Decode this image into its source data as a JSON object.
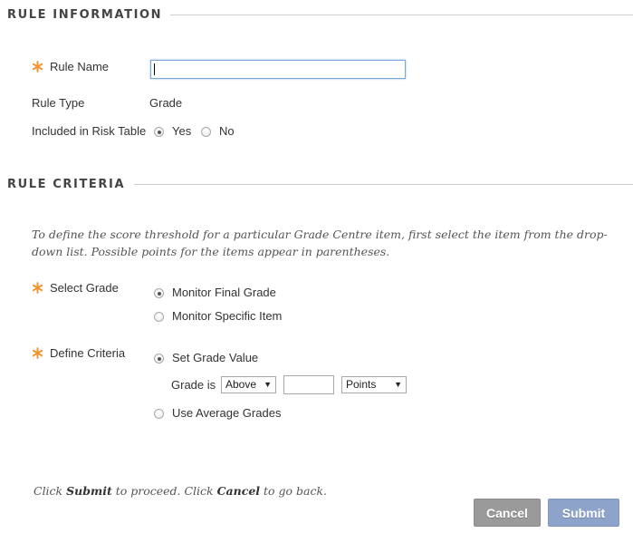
{
  "rule_information": {
    "title": "RULE INFORMATION",
    "rule_name": {
      "label": "Rule Name",
      "value": ""
    },
    "rule_type": {
      "label": "Rule Type",
      "value": "Grade"
    },
    "risk_table": {
      "label": "Included in Risk Table",
      "options": [
        {
          "label": "Yes",
          "selected": true
        },
        {
          "label": "No",
          "selected": false
        }
      ]
    }
  },
  "rule_criteria": {
    "title": "RULE CRITERIA",
    "instructions": "To define the score threshold for a particular Grade Centre item, first select the item from the drop-down list. Possible points for the items appear in parentheses.",
    "select_grade": {
      "label": "Select Grade",
      "options": [
        {
          "label": "Monitor Final Grade",
          "selected": true
        },
        {
          "label": "Monitor Specific Item",
          "selected": false
        }
      ]
    },
    "define_criteria": {
      "label": "Define Criteria",
      "set_grade_value": {
        "label": "Set Grade Value",
        "selected": true
      },
      "grade_is_label": "Grade is",
      "comparison": "Above",
      "threshold_value": "",
      "unit": "Points",
      "use_average": {
        "label": "Use Average Grades",
        "selected": false
      }
    }
  },
  "footer": {
    "submit_word": "Submit",
    "cancel_word": "Cancel",
    "hint_parts": [
      "Click ",
      "Submit",
      " to proceed. Click ",
      "Cancel",
      " to go back."
    ],
    "cancel_button": "Cancel",
    "submit_button": "Submit"
  },
  "colors": {
    "required_asterisk": "#f5922f",
    "cancel_button": "#999999",
    "submit_button": "#8ea3c9",
    "input_focus_border": "#7aa7d6"
  },
  "icons": {
    "required": "asterisk-icon",
    "dropdown": "chevron-down-icon"
  }
}
